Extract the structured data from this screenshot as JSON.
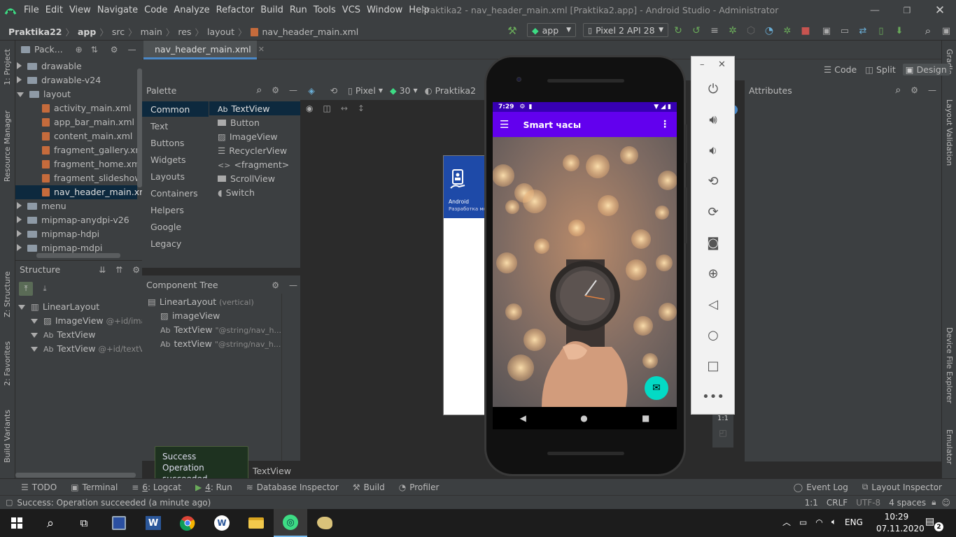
{
  "window": {
    "title": "Praktika2 - nav_header_main.xml [Praktika2.app] - Android Studio - Administrator",
    "menu": [
      "File",
      "Edit",
      "View",
      "Navigate",
      "Code",
      "Analyze",
      "Refactor",
      "Build",
      "Run",
      "Tools",
      "VCS",
      "Window",
      "Help"
    ]
  },
  "breadcrumb": {
    "project": "Praktika22",
    "items": [
      "app",
      "src",
      "main",
      "res",
      "layout"
    ],
    "file": "nav_header_main.xml"
  },
  "toolbar": {
    "run_config": "app",
    "device": "Pixel 2 API 28"
  },
  "left_strip": {
    "project": "1: Project",
    "resource_manager": "Resource Manager",
    "structure": "Z: Structure",
    "favorites": "2: Favorites",
    "build_variants": "Build Variants"
  },
  "right_strip": {
    "gradle": "Gradle",
    "layout_validation": "Layout Validation",
    "device_file_explorer": "Device File Explorer",
    "emulator": "Emulator"
  },
  "project_panel": {
    "view_selector": "Pack...",
    "tree": [
      {
        "label": "drawable",
        "type": "folder",
        "expanded": false
      },
      {
        "label": "drawable-v24",
        "type": "folder",
        "expanded": false
      },
      {
        "label": "layout",
        "type": "folder",
        "expanded": true
      },
      {
        "label": "activity_main.xml",
        "type": "file"
      },
      {
        "label": "app_bar_main.xml",
        "type": "file"
      },
      {
        "label": "content_main.xml",
        "type": "file"
      },
      {
        "label": "fragment_gallery.xml",
        "type": "file"
      },
      {
        "label": "fragment_home.xml",
        "type": "file"
      },
      {
        "label": "fragment_slideshow.xm",
        "type": "file"
      },
      {
        "label": "nav_header_main.xml",
        "type": "file",
        "selected": true
      },
      {
        "label": "menu",
        "type": "folder",
        "expanded": false
      },
      {
        "label": "mipmap-anydpi-v26",
        "type": "folder",
        "expanded": false
      },
      {
        "label": "mipmap-hdpi",
        "type": "folder",
        "expanded": false
      },
      {
        "label": "mipmap-mdpi",
        "type": "folder",
        "expanded": false
      }
    ]
  },
  "structure_panel": {
    "title": "Structure",
    "tree": [
      {
        "label": "LinearLayout",
        "hint": ""
      },
      {
        "label": "ImageView",
        "hint": "@+id/imag"
      },
      {
        "label": "TextView",
        "hint": ""
      },
      {
        "label": "TextView",
        "hint": "@+id/textVie"
      }
    ]
  },
  "editor_tab": {
    "label": "nav_header_main.xml"
  },
  "view_modes": {
    "code": "Code",
    "split": "Split",
    "design": "Design"
  },
  "palette": {
    "title": "Palette",
    "categories": [
      "Common",
      "Text",
      "Buttons",
      "Widgets",
      "Layouts",
      "Containers",
      "Helpers",
      "Google",
      "Legacy"
    ],
    "widgets": [
      "TextView",
      "Button",
      "ImageView",
      "RecyclerView",
      "<fragment>",
      "ScrollView",
      "Switch"
    ]
  },
  "canvas_toolbar": {
    "device": "Pixel",
    "api": "30",
    "theme": "Praktika2"
  },
  "component_tree": {
    "title": "Component Tree",
    "items": [
      {
        "label": "LinearLayout",
        "hint": "(vertical)"
      },
      {
        "label": "imageView",
        "hint": ""
      },
      {
        "label": "TextView",
        "hint": "\"@string/nav_h..."
      },
      {
        "label": "textView",
        "hint": "\"@string/nav_h..."
      }
    ]
  },
  "attributes": {
    "title": "Attributes"
  },
  "preview": {
    "line1": "Android",
    "line2": "Разработка мос"
  },
  "emulator": {
    "time": "7:29",
    "app_title": "Smart часы",
    "zoom_label": "1:1"
  },
  "toast": {
    "title": "Success",
    "message": "Operation succeeded"
  },
  "bottom_tabs": {
    "todo": "TODO",
    "terminal": "Terminal",
    "logcat_num": "6",
    "logcat": ": Logcat",
    "run_num": "4",
    "run": ": Run",
    "db": "Database Inspector",
    "build": "Build",
    "profiler": "Profiler",
    "event_log": "Event Log",
    "layout_inspector": "Layout Inspector",
    "textview_crumb": "TextView"
  },
  "status": {
    "message": "Success: Operation succeeded (a minute ago)",
    "position": "1:1",
    "line_sep": "CRLF",
    "encoding": "UTF-8",
    "indent": "4 spaces"
  },
  "taskbar": {
    "lang": "ENG",
    "time": "10:29",
    "date": "07.11.2020",
    "notifications": "2"
  },
  "colors": {
    "ide_bg": "#2b2b2b",
    "panel_bg": "#3c3f41",
    "selection": "#0d293e",
    "app_bar": "#6200ee",
    "status_bar": "#3700b3",
    "fab": "#03dac5",
    "preview_header": "#1e4aa8"
  }
}
